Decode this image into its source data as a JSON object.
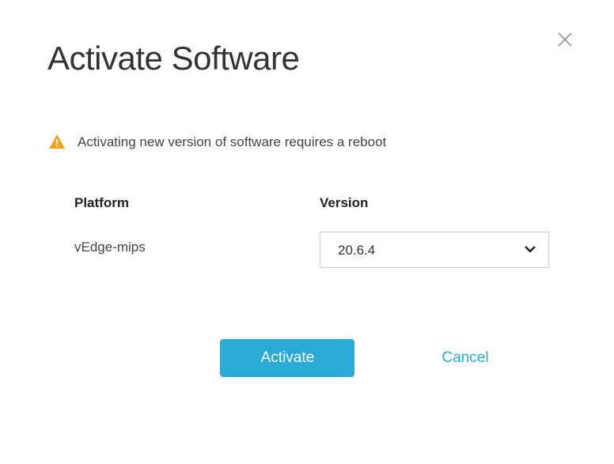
{
  "dialog": {
    "title": "Activate Software",
    "warning": "Activating new version of software requires a reboot"
  },
  "form": {
    "platform_label": "Platform",
    "platform_value": "vEdge-mips",
    "version_label": "Version",
    "version_selected": "20.6.4"
  },
  "buttons": {
    "activate": "Activate",
    "cancel": "Cancel"
  }
}
